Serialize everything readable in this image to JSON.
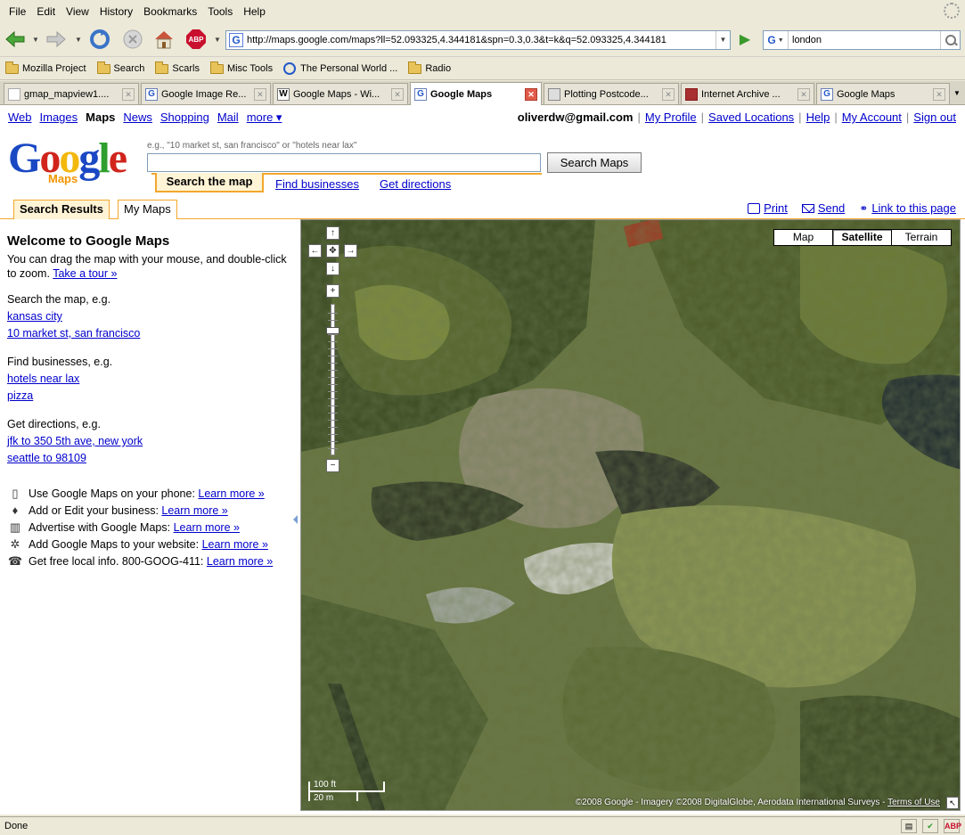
{
  "browser": {
    "menu": [
      "File",
      "Edit",
      "View",
      "History",
      "Bookmarks",
      "Tools",
      "Help"
    ],
    "url": "http://maps.google.com/maps?ll=52.093325,4.344181&spn=0.3,0.3&t=k&q=52.093325,4.344181",
    "search_engine_letter": "G",
    "search_value": "london",
    "abp_label": "ABP",
    "bookmarks": [
      "Mozilla Project",
      "Search",
      "Scarls",
      "Misc Tools",
      "The Personal World ...",
      "Radio"
    ],
    "tabs": [
      {
        "title": "gmap_mapview1....",
        "icon": ""
      },
      {
        "title": "Google Image Re...",
        "icon": "G"
      },
      {
        "title": "Google Maps - Wi...",
        "icon": "W"
      },
      {
        "title": "Google Maps",
        "icon": "G"
      },
      {
        "title": "Plotting Postcode...",
        "icon": ""
      },
      {
        "title": "Internet Archive ...",
        "icon": ""
      },
      {
        "title": "Google Maps",
        "icon": "G"
      }
    ],
    "status_text": "Done"
  },
  "gbar": {
    "links": [
      "Web",
      "Images",
      "Maps",
      "News",
      "Shopping",
      "Mail",
      "more ▾"
    ],
    "user_email": "oliverdw@gmail.com",
    "account_links": [
      "My Profile",
      "Saved Locations",
      "Help",
      "My Account",
      "Sign out"
    ]
  },
  "logo": {
    "text": "Google",
    "sub": "Maps"
  },
  "search": {
    "hint": "e.g., \"10 market st, san francisco\" or \"hotels near lax\"",
    "button": "Search Maps",
    "tab_active": "Search the map",
    "tab_businesses": "Find businesses",
    "tab_directions": "Get directions"
  },
  "panel_tabs": {
    "results": "Search Results",
    "mymaps": "My Maps"
  },
  "tools": {
    "print": "Print",
    "send": "Send",
    "link": "Link to this page"
  },
  "sidebar": {
    "title": "Welcome to Google Maps",
    "intro": "You can drag the map with your mouse, and double-click to zoom.",
    "tour": "Take a tour »",
    "search_label": "Search the map, e.g.",
    "search_examples": [
      "kansas city",
      "10 market st, san francisco"
    ],
    "business_label": "Find businesses, e.g.",
    "business_examples": [
      "hotels near lax",
      "pizza"
    ],
    "directions_label": "Get directions, e.g.",
    "directions_examples": [
      "jfk to 350 5th ave, new york",
      "seattle to 98109"
    ],
    "extras": [
      {
        "icon": "phone-icon",
        "glyph": "▯",
        "text": "Use Google Maps on your phone:",
        "link": "Learn more »"
      },
      {
        "icon": "pin-icon",
        "glyph": "♦",
        "text": "Add or Edit your business:",
        "link": "Learn more »"
      },
      {
        "icon": "ads-icon",
        "glyph": "▥",
        "text": "Advertise with Google Maps:",
        "link": "Learn more »"
      },
      {
        "icon": "gear-icon",
        "glyph": "✲",
        "text": "Add Google Maps to your website:",
        "link": "Learn more »"
      },
      {
        "icon": "telephone-icon",
        "glyph": "☎",
        "text": "Get free local info. 800-GOOG-411:",
        "link": "Learn more »"
      }
    ]
  },
  "map": {
    "types": [
      "Map",
      "Satellite",
      "Terrain"
    ],
    "selected_type": "Satellite",
    "scale_top": "100 ft",
    "scale_bottom": "20 m",
    "copyright": "©2008 Google - Imagery ©2008 DigitalGlobe, Aerodata International Surveys - ",
    "terms": "Terms of Use"
  }
}
